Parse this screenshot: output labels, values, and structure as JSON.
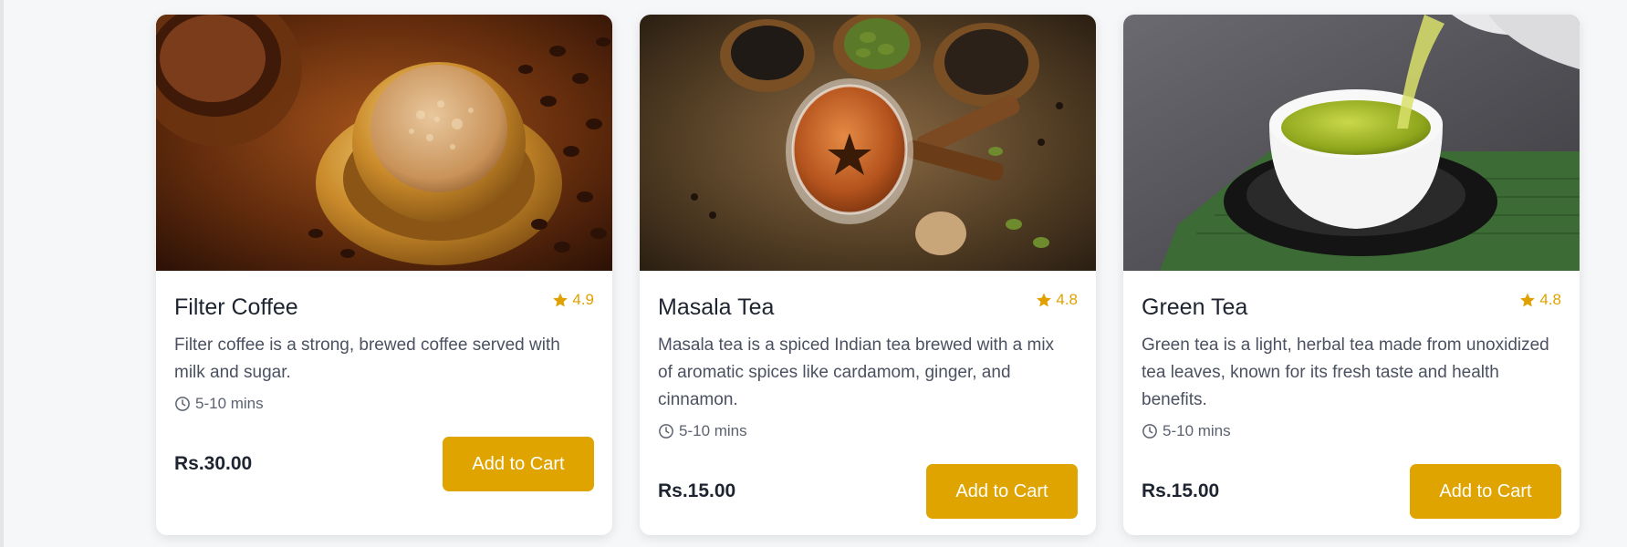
{
  "accent_color": "#e0a400",
  "rating_color": "#e0a100",
  "cards": [
    {
      "image_name": "filter-coffee-photo",
      "title": "Filter Coffee",
      "rating": "4.9",
      "description": "Filter coffee is a strong, brewed coffee served with milk and sugar.",
      "prep_time": "5-10 mins",
      "price": "Rs.30.00",
      "button_label": "Add to Cart"
    },
    {
      "image_name": "masala-tea-photo",
      "title": "Masala Tea",
      "rating": "4.8",
      "description": "Masala tea is a spiced Indian tea brewed with a mix of aromatic spices like cardamom, ginger, and cinnamon.",
      "prep_time": "5-10 mins",
      "price": "Rs.15.00",
      "button_label": "Add to Cart"
    },
    {
      "image_name": "green-tea-photo",
      "title": "Green Tea",
      "rating": "4.8",
      "description": "Green tea is a light, herbal tea made from unoxidized tea leaves, known for its fresh taste and health benefits.",
      "prep_time": "5-10 mins",
      "price": "Rs.15.00",
      "button_label": "Add to Cart"
    }
  ]
}
